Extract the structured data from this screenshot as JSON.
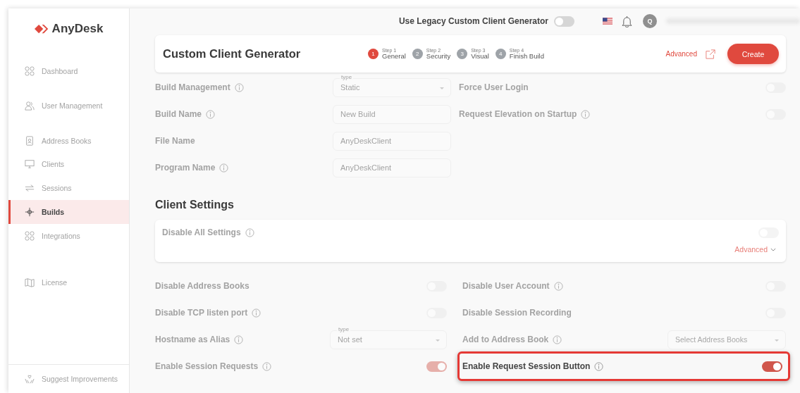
{
  "brand": {
    "name": "AnyDesk"
  },
  "sidebar": {
    "items": [
      {
        "label": "Dashboard",
        "selected": false
      },
      {
        "label": "User Management",
        "selected": false
      },
      {
        "label": "Address Books",
        "selected": false
      },
      {
        "label": "Clients",
        "selected": false
      },
      {
        "label": "Sessions",
        "selected": false
      },
      {
        "label": "Builds",
        "selected": true
      },
      {
        "label": "Integrations",
        "selected": false
      },
      {
        "label": "License",
        "selected": false
      }
    ],
    "footer": "Suggest Improvements"
  },
  "topbar": {
    "legacy_label": "Use Legacy Custom Client Generator",
    "legacy_on": false,
    "avatar": "Q"
  },
  "header": {
    "title": "Custom Client Generator",
    "steps": [
      {
        "step": "Step 1",
        "number": "1",
        "label": "General",
        "selected": true
      },
      {
        "step": "Step 2",
        "number": "2",
        "label": "Security",
        "selected": false
      },
      {
        "step": "Step 3",
        "number": "3",
        "label": "Visual",
        "selected": false
      },
      {
        "step": "Step 4",
        "number": "4",
        "label": "Finish Build",
        "selected": false
      }
    ],
    "advanced": "Advanced",
    "create": "Create"
  },
  "build": {
    "left": [
      {
        "label": "Build Management",
        "info": true,
        "kind": "select",
        "caption": "type",
        "value": "Static"
      },
      {
        "label": "Build Name",
        "info": true,
        "kind": "input",
        "value": "New Build"
      },
      {
        "label": "File Name",
        "info": false,
        "kind": "input",
        "value": "AnyDeskClient"
      },
      {
        "label": "Program Name",
        "info": true,
        "kind": "input",
        "value": "AnyDeskClient"
      }
    ],
    "right": [
      {
        "label": "Force User Login",
        "info": false,
        "kind": "toggle",
        "on": false
      },
      {
        "label": "Request Elevation on Startup",
        "info": true,
        "kind": "toggle",
        "on": false
      }
    ]
  },
  "client_settings": {
    "title": "Client Settings",
    "disable_all": {
      "label": "Disable All Settings",
      "info": true,
      "on": false
    },
    "advanced": "Advanced",
    "items": [
      {
        "label": "Disable Address Books",
        "info": false,
        "kind": "toggle",
        "on": false,
        "highlighted": false
      },
      {
        "label": "Disable User Account",
        "info": true,
        "kind": "toggle",
        "on": false,
        "highlighted": false
      },
      {
        "label": "Disable TCP listen port",
        "info": true,
        "kind": "toggle",
        "on": false,
        "highlighted": false
      },
      {
        "label": "Disable Session Recording",
        "info": false,
        "kind": "toggle",
        "on": false,
        "highlighted": false
      },
      {
        "label": "Hostname as Alias",
        "info": true,
        "kind": "select",
        "caption": "type",
        "value": "Not set",
        "highlighted": false
      },
      {
        "label": "Add to Address Book",
        "info": true,
        "kind": "select",
        "placeholder": "Select Address Books",
        "highlighted": false
      },
      {
        "label": "Enable Session Requests",
        "info": true,
        "kind": "toggle",
        "on": true,
        "highlighted": false
      },
      {
        "label": "Enable Request Session Button",
        "info": true,
        "kind": "toggle",
        "on": true,
        "highlighted": true
      }
    ]
  }
}
